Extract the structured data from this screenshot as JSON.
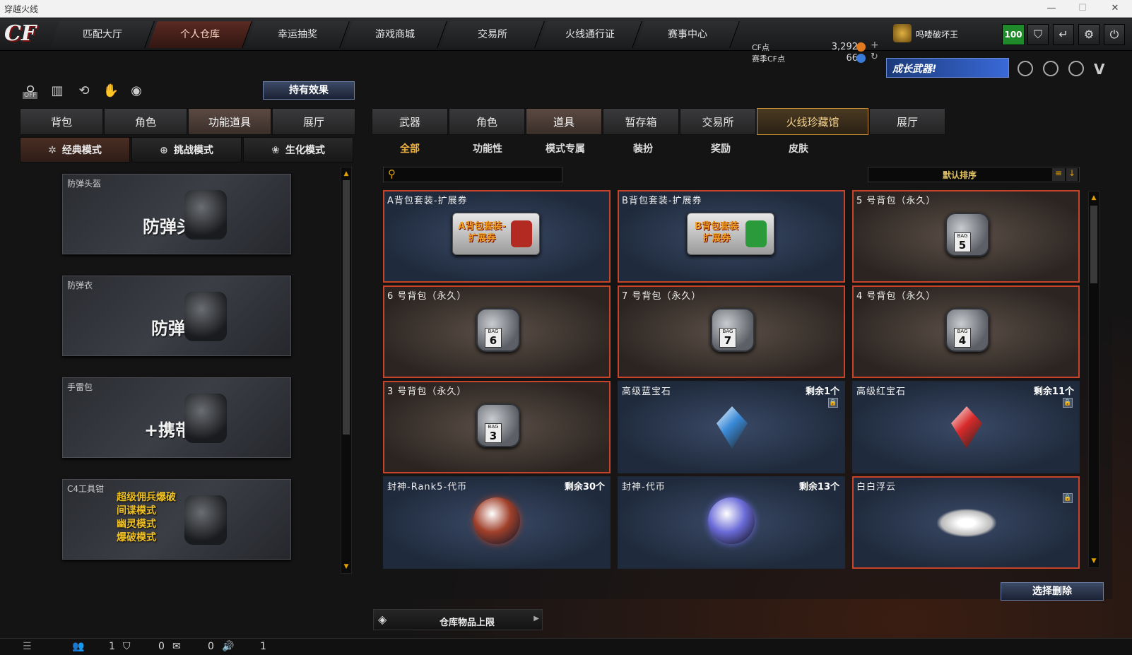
{
  "window": {
    "title": "穿越火线",
    "minimize": "—",
    "maximize": "☐",
    "close": "✕"
  },
  "logo": "CF",
  "nav": [
    {
      "label": "匹配大厅"
    },
    {
      "label": "个人仓库"
    },
    {
      "label": "幸运抽奖"
    },
    {
      "label": "游戏商城"
    },
    {
      "label": "交易所"
    },
    {
      "label": "火线通行证"
    },
    {
      "label": "赛事中心"
    }
  ],
  "currency": {
    "cf_label": "CF点",
    "cf_value": "3,292",
    "season_label": "赛季CF点",
    "season_value": "66"
  },
  "player": {
    "name": "吗喽破坏王",
    "level": "100"
  },
  "top_icons": [
    "shield-icon",
    "return-icon",
    "gear-icon",
    "power-icon"
  ],
  "banner": "成长武器!",
  "left": {
    "hold_effect": "持有效果",
    "off_label": "OFF",
    "tabs": [
      {
        "label": "背包"
      },
      {
        "label": "角色"
      },
      {
        "label": "功能道具"
      },
      {
        "label": "展厅"
      }
    ],
    "modes": [
      {
        "label": "经典模式"
      },
      {
        "label": "挑战模式"
      },
      {
        "label": "生化模式"
      }
    ],
    "cards": [
      {
        "label": "防弹头盔",
        "big": "防弹头盔"
      },
      {
        "label": "防弹衣",
        "big": "防弹衣"
      },
      {
        "label": "手雷包",
        "big": "+携带数"
      },
      {
        "label": "C4工具钳",
        "big": "超级佣兵爆破\n间谍模式\n幽灵模式\n爆破模式"
      }
    ]
  },
  "right": {
    "tabs": [
      {
        "label": "武器"
      },
      {
        "label": "角色"
      },
      {
        "label": "道具"
      },
      {
        "label": "暂存箱"
      },
      {
        "label": "交易所"
      },
      {
        "label": "火线珍藏馆"
      },
      {
        "label": "展厅"
      }
    ],
    "subtabs": [
      {
        "label": "全部"
      },
      {
        "label": "功能性"
      },
      {
        "label": "模式专属"
      },
      {
        "label": "装扮"
      },
      {
        "label": "奖励"
      },
      {
        "label": "皮肤"
      }
    ],
    "search_placeholder": "",
    "sort": "默认排序",
    "items": [
      {
        "name": "A背包套装-扩展券",
        "count": "",
        "kind": "coupon",
        "coupon_text": "A背包套装-扩展券",
        "color": "#b22a22"
      },
      {
        "name": "B背包套装-扩展券",
        "count": "",
        "kind": "coupon",
        "coupon_text": "B背包套装扩展券",
        "color": "#2a9a3a"
      },
      {
        "name": "5 号背包（永久）",
        "count": "",
        "kind": "bag",
        "bag_no": "5"
      },
      {
        "name": "6 号背包（永久）",
        "count": "",
        "kind": "bag",
        "bag_no": "6"
      },
      {
        "name": "7 号背包（永久）",
        "count": "",
        "kind": "bag",
        "bag_no": "7"
      },
      {
        "name": "4 号背包（永久）",
        "count": "",
        "kind": "bag",
        "bag_no": "4"
      },
      {
        "name": "3 号背包（永久）",
        "count": "",
        "kind": "bag",
        "bag_no": "3"
      },
      {
        "name": "高级蓝宝石",
        "count": "剩余1个",
        "kind": "gem",
        "color": "#3a8ad8"
      },
      {
        "name": "高级红宝石",
        "count": "剩余11个",
        "kind": "gem",
        "color": "#d82a2a"
      },
      {
        "name": "封神-Rank5-代币",
        "count": "剩余30个",
        "kind": "token",
        "color": "#a0402a"
      },
      {
        "name": "封神-代币",
        "count": "剩余13个",
        "kind": "token",
        "color": "#6a6ad8"
      },
      {
        "name": "白白浮云",
        "count": "",
        "kind": "cloud"
      }
    ],
    "delete_btn": "选择删除",
    "capacity": "仓库物品上限"
  },
  "status": {
    "friends": "1",
    "shield": "0",
    "chat": "0",
    "sound": "1"
  }
}
